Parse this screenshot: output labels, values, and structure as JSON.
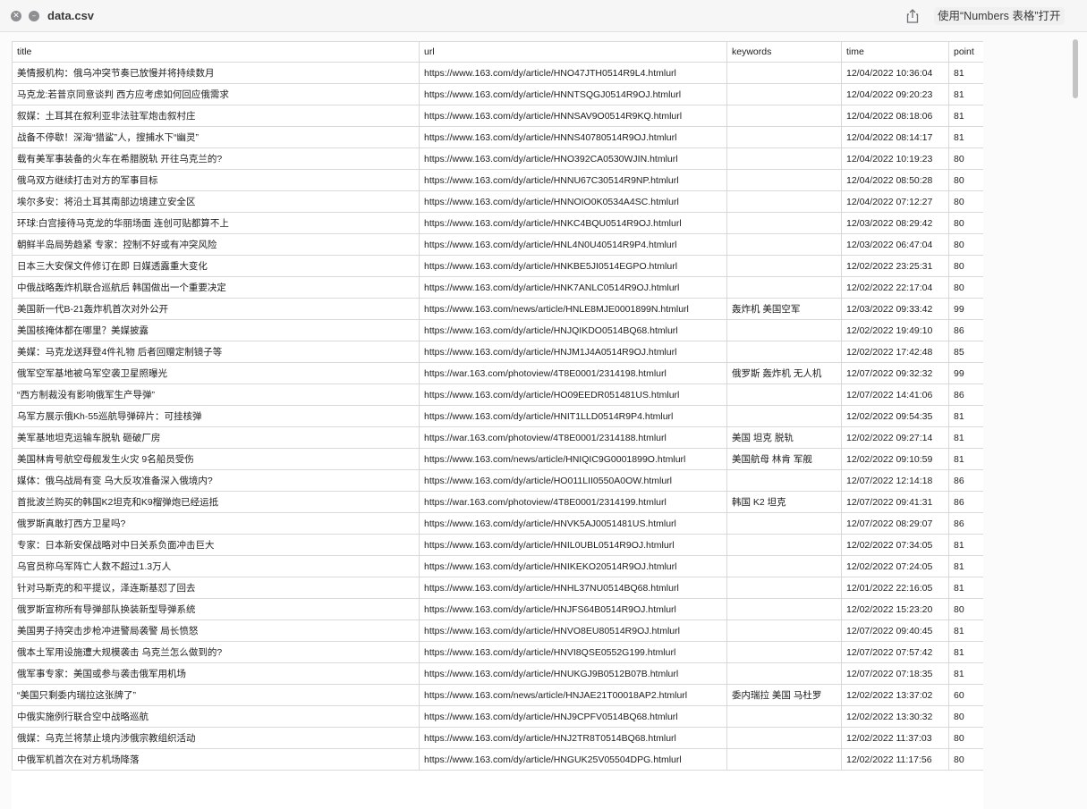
{
  "window": {
    "title": "data.csv",
    "open_with_label": "使用“Numbers 表格”打开",
    "icons": [
      "close-icon",
      "minus-icon",
      "share-icon"
    ]
  },
  "table": {
    "headers": [
      "title",
      "url",
      "keywords",
      "time",
      "point"
    ],
    "rows": [
      [
        "美情报机构：俄乌冲突节奏已放慢并将持续数月",
        "https://www.163.com/dy/article/HNO47JTH0514R9L4.htmlurl",
        "",
        "12/04/2022 10:36:04",
        "81"
      ],
      [
        "马克龙:若普京同意谈判 西方应考虑如何回应俄需求",
        "https://www.163.com/dy/article/HNNTSQGJ0514R9OJ.htmlurl",
        "",
        "12/04/2022 09:20:23",
        "81"
      ],
      [
        "叙媒：土耳其在叙利亚非法驻军炮击叙村庄",
        "https://www.163.com/dy/article/HNNSAV9O0514R9KQ.htmlurl",
        "",
        "12/04/2022 08:18:06",
        "81"
      ],
      [
        "战备不停歇！深海“猎鲨”人，搜捕水下“幽灵”",
        "https://www.163.com/dy/article/HNNS40780514R9OJ.htmlurl",
        "",
        "12/04/2022 08:14:17",
        "81"
      ],
      [
        "载有美军事装备的火车在希腊脱轨 开往乌克兰的?",
        "https://www.163.com/dy/article/HNO392CA0530WJIN.htmlurl",
        "",
        "12/04/2022 10:19:23",
        "80"
      ],
      [
        "俄乌双方继续打击对方的军事目标",
        "https://www.163.com/dy/article/HNNU67C30514R9NP.htmlurl",
        "",
        "12/04/2022 08:50:28",
        "80"
      ],
      [
        "埃尔多安：将沿土耳其南部边境建立安全区",
        "https://www.163.com/dy/article/HNNOIO0K0534A4SC.htmlurl",
        "",
        "12/04/2022 07:12:27",
        "80"
      ],
      [
        "环球:白宫接待马克龙的华丽场面 连创可贴都算不上",
        "https://www.163.com/dy/article/HNKC4BQU0514R9OJ.htmlurl",
        "",
        "12/03/2022 08:29:42",
        "80"
      ],
      [
        "朝鲜半岛局势趋紧 专家：控制不好或有冲突风险",
        "https://www.163.com/dy/article/HNL4N0U40514R9P4.htmlurl",
        "",
        "12/03/2022 06:47:04",
        "80"
      ],
      [
        "日本三大安保文件修订在即 日媒透露重大变化",
        "https://www.163.com/dy/article/HNKBE5JI0514EGPO.htmlurl",
        "",
        "12/02/2022 23:25:31",
        "80"
      ],
      [
        "中俄战略轰炸机联合巡航后 韩国做出一个重要决定",
        "https://www.163.com/dy/article/HNK7ANLC0514R9OJ.htmlurl",
        "",
        "12/02/2022 22:17:04",
        "80"
      ],
      [
        "美国新一代B-21轰炸机首次对外公开",
        "https://www.163.com/news/article/HNLE8MJE0001899N.htmlurl",
        "轰炸机 美国空军",
        "12/03/2022 09:33:42",
        "99"
      ],
      [
        "美国核掩体都在哪里？美媒披露",
        "https://www.163.com/dy/article/HNJQIKDO0514BQ68.htmlurl",
        "",
        "12/02/2022 19:49:10",
        "86"
      ],
      [
        "美媒：马克龙送拜登4件礼物 后者回赠定制镜子等",
        "https://www.163.com/dy/article/HNJM1J4A0514R9OJ.htmlurl",
        "",
        "12/02/2022 17:42:48",
        "85"
      ],
      [
        "俄军空军基地被乌军空袭卫星照曝光",
        "https://war.163.com/photoview/4T8E0001/2314198.htmlurl",
        "俄罗斯 轰炸机 无人机",
        "12/07/2022 09:32:32",
        "99"
      ],
      [
        "“西方制裁没有影响俄军生产导弹”",
        "https://www.163.com/dy/article/HO09EEDR051481US.htmlurl",
        "",
        "12/07/2022 14:41:06",
        "86"
      ],
      [
        "乌军方展示俄Kh-55巡航导弹碎片：可挂核弹",
        "https://www.163.com/dy/article/HNIT1LLD0514R9P4.htmlurl",
        "",
        "12/02/2022 09:54:35",
        "81"
      ],
      [
        "美军基地坦克运输车脱轨 砸破厂房",
        "https://war.163.com/photoview/4T8E0001/2314188.htmlurl",
        "美国 坦克 脱轨",
        "12/02/2022 09:27:14",
        "81"
      ],
      [
        "美国林肯号航空母舰发生火灾 9名船员受伤",
        "https://www.163.com/news/article/HNIQIC9G0001899O.htmlurl",
        "美国航母 林肯 军舰",
        "12/02/2022 09:10:59",
        "81"
      ],
      [
        "媒体：俄乌战局有变 乌大反攻准备深入俄境内?",
        "https://www.163.com/dy/article/HO011LII0550A0OW.htmlurl",
        "",
        "12/07/2022 12:14:18",
        "86"
      ],
      [
        "首批波兰购买的韩国K2坦克和K9榴弹炮已经运抵",
        "https://war.163.com/photoview/4T8E0001/2314199.htmlurl",
        "韩国 K2 坦克",
        "12/07/2022 09:41:31",
        "86"
      ],
      [
        "俄罗斯真敢打西方卫星吗?",
        "https://www.163.com/dy/article/HNVK5AJ0051481US.htmlurl",
        "",
        "12/07/2022 08:29:07",
        "86"
      ],
      [
        "专家：日本新安保战略对中日关系负面冲击巨大",
        "https://www.163.com/dy/article/HNIL0UBL0514R9OJ.htmlurl",
        "",
        "12/02/2022 07:34:05",
        "81"
      ],
      [
        "乌官员称乌军阵亡人数不超过1.3万人",
        "https://www.163.com/dy/article/HNIKEKO20514R9OJ.htmlurl",
        "",
        "12/02/2022 07:24:05",
        "81"
      ],
      [
        "针对马斯克的和平提议，泽连斯基怼了回去",
        "https://www.163.com/dy/article/HNHL37NU0514BQ68.htmlurl",
        "",
        "12/01/2022 22:16:05",
        "81"
      ],
      [
        "俄罗斯宣称所有导弹部队换装新型导弹系统",
        "https://www.163.com/dy/article/HNJFS64B0514R9OJ.htmlurl",
        "",
        "12/02/2022 15:23:20",
        "80"
      ],
      [
        "美国男子持突击步枪冲进警局袭警 局长愤怒",
        "https://www.163.com/dy/article/HNVO8EU80514R9OJ.htmlurl",
        "",
        "12/07/2022 09:40:45",
        "81"
      ],
      [
        "俄本土军用设施遭大规模袭击 乌克兰怎么做到的?",
        "https://www.163.com/dy/article/HNVI8QSE0552G199.htmlurl",
        "",
        "12/07/2022 07:57:42",
        "81"
      ],
      [
        "俄军事专家：美国或参与袭击俄军用机场",
        "https://www.163.com/dy/article/HNUKGJ9B0512B07B.htmlurl",
        "",
        "12/07/2022 07:18:35",
        "81"
      ],
      [
        "“美国只剩委内瑞拉这张牌了”",
        "https://www.163.com/news/article/HNJAE21T00018AP2.htmlurl",
        "委内瑞拉 美国 马杜罗",
        "12/02/2022 13:37:02",
        "60"
      ],
      [
        "中俄实施例行联合空中战略巡航",
        "https://www.163.com/dy/article/HNJ9CPFV0514BQ68.htmlurl",
        "",
        "12/02/2022 13:30:32",
        "80"
      ],
      [
        "俄媒：乌克兰将禁止境内涉俄宗教组织活动",
        "https://www.163.com/dy/article/HNJ2TR8T0514BQ68.htmlurl",
        "",
        "12/02/2022 11:37:03",
        "80"
      ],
      [
        "中俄军机首次在对方机场降落",
        "https://www.163.com/dy/article/HNGUK25V05504DPG.htmlurl",
        "",
        "12/02/2022 11:17:56",
        "80"
      ]
    ]
  }
}
